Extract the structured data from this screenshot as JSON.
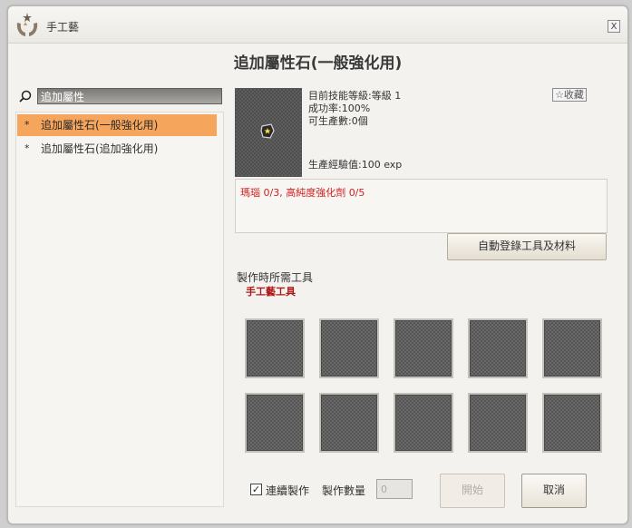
{
  "window": {
    "title": "手工藝",
    "close_label": "X"
  },
  "main_title": "追加屬性石(一般強化用)",
  "search": {
    "value": "追加屬性"
  },
  "recipes": [
    {
      "label": "追加屬性石(一般強化用)",
      "selected": true
    },
    {
      "label": "追加屬性石(追加強化用)",
      "selected": false
    }
  ],
  "recipe_bullet": "*",
  "item_icon": "gem-icon",
  "info": {
    "skill_level": "目前技能等級:等級 1",
    "success_rate": "成功率:100%",
    "producible": "可生產數:0個",
    "exp": "生產經驗值:100 exp"
  },
  "favorite_label": "☆收藏",
  "materials_text": "瑪瑙 0/3, 高純度強化劑 0/5",
  "auto_register_label": "自動登錄工具及材料",
  "tools": {
    "label": "製作時所需工具",
    "name": "手工藝工具"
  },
  "slot_count": 10,
  "continuous": {
    "label": "連續製作",
    "checked": true
  },
  "quantity": {
    "label": "製作數量",
    "value": "0"
  },
  "start_label": "開始",
  "cancel_label": "取消",
  "colors": {
    "selected_row": "#f5a55c",
    "material_text": "#d22020",
    "tool_name": "#b01818"
  }
}
